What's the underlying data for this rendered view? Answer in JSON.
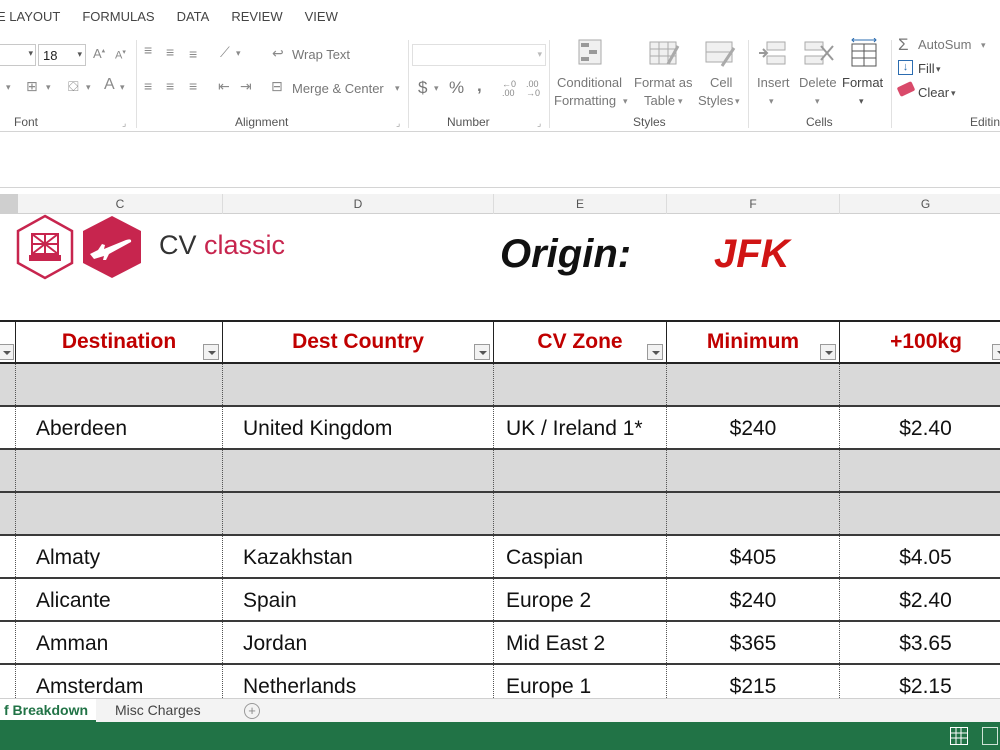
{
  "menu": {
    "tabs": [
      "E LAYOUT",
      "FORMULAS",
      "DATA",
      "REVIEW",
      "VIEW"
    ]
  },
  "ribbon": {
    "font": {
      "size": "18",
      "label": "Font"
    },
    "alignment": {
      "wrap_text": "Wrap Text",
      "merge_center": "Merge & Center",
      "label": "Alignment"
    },
    "number": {
      "currency": "$",
      "percent": "%",
      "comma": ",",
      "label": "Number"
    },
    "styles": {
      "conditional_1": "Conditional",
      "conditional_2": "Formatting",
      "format_table_1": "Format as",
      "format_table_2": "Table",
      "cell_styles_1": "Cell",
      "cell_styles_2": "Styles",
      "label": "Styles"
    },
    "cells": {
      "insert": "Insert",
      "delete": "Delete",
      "format": "Format",
      "label": "Cells"
    },
    "editing": {
      "autosum": "AutoSum",
      "fill": "Fill",
      "clear": "Clear",
      "label": "Editin"
    }
  },
  "columns": [
    "C",
    "D",
    "E",
    "F",
    "G"
  ],
  "brand": {
    "cv": "CV",
    "classic": "classic"
  },
  "origin": {
    "label": "Origin:",
    "value": "JFK"
  },
  "table": {
    "headers": [
      "Destination",
      "Dest Country",
      "CV Zone",
      "Minimum",
      "+100kg"
    ],
    "rows": [
      {
        "destination": "",
        "country": "",
        "zone": "",
        "minimum": "",
        "rate": ""
      },
      {
        "destination": "Aberdeen",
        "country": "United Kingdom",
        "zone": "UK / Ireland 1*",
        "minimum": "$240",
        "rate": "$2.40"
      },
      {
        "destination": "",
        "country": "",
        "zone": "",
        "minimum": "",
        "rate": ""
      },
      {
        "destination": "",
        "country": "",
        "zone": "",
        "minimum": "",
        "rate": ""
      },
      {
        "destination": "Almaty",
        "country": "Kazakhstan",
        "zone": "Caspian",
        "minimum": "$405",
        "rate": "$4.05"
      },
      {
        "destination": "Alicante",
        "country": "Spain",
        "zone": "Europe 2",
        "minimum": "$240",
        "rate": "$2.40"
      },
      {
        "destination": "Amman",
        "country": "Jordan",
        "zone": "Mid East 2",
        "minimum": "$365",
        "rate": "$3.65"
      },
      {
        "destination": "Amsterdam",
        "country": "Netherlands",
        "zone": "Europe 1",
        "minimum": "$215",
        "rate": "$2.15"
      }
    ]
  },
  "sheet_tabs": {
    "active": "f Breakdown",
    "misc": "Misc Charges",
    "add": "+"
  },
  "colors": {
    "excel_green": "#217346",
    "header_red": "#c00000",
    "origin_red": "#d01515",
    "brand_crimson": "#c7254e",
    "blank_row": "#d9d9d9"
  }
}
